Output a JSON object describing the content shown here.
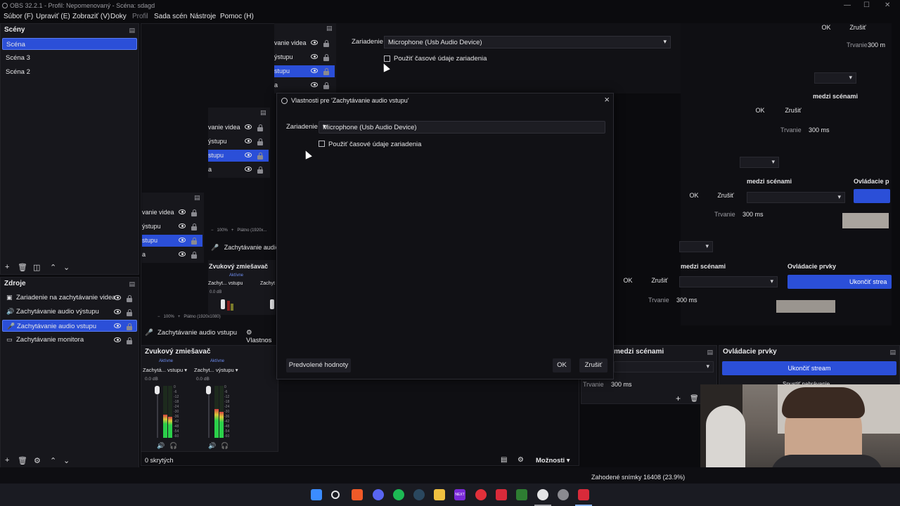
{
  "window": {
    "title": "OBS 32.2.1 - Profil: Nepomenovaný - Scéna: sdagd",
    "controls": [
      "—",
      "☐",
      "✕"
    ]
  },
  "menu": [
    "Súbor (F)",
    "Upraviť (E)",
    "Zobraziť (V)",
    "Doky",
    "Profil",
    "Sada scén",
    "Nástroje",
    "Pomoc (H)"
  ],
  "scenes": {
    "title": "Scény",
    "items": [
      "Scéna",
      "Scéna 3",
      "Scéna 2"
    ],
    "selected_index": 0
  },
  "sources": {
    "title": "Zdroje",
    "items": [
      {
        "label": "Zariadenie na zachytávanie videa",
        "icon": "camera-icon"
      },
      {
        "label": "Zachytávanie audio výstupu",
        "icon": "speaker-icon"
      },
      {
        "label": "Zachytávanie audio vstupu",
        "icon": "microphone-icon"
      },
      {
        "label": "Zachytávanie monitora",
        "icon": "monitor-icon"
      }
    ],
    "selected_index": 2
  },
  "ghost_sources": {
    "a": [
      "vanie videa",
      "ýstupu",
      "stupu",
      "a"
    ],
    "b": [
      "vanie videa",
      "ýstupu",
      "stupu",
      "a"
    ],
    "c": [
      "vanie videa",
      "ýstupu",
      "stupu",
      "a"
    ]
  },
  "zoom_row_a": {
    "zoom": "100%",
    "res": "Plátno (1920x..."
  },
  "zoom_row_b": {
    "zoom": "100%",
    "res": "Plátno (1920x1080)"
  },
  "ghost_audio_label": "Zachytávanie audio",
  "ghost_mixer_a": {
    "title": "Zvukový zmiešavač",
    "status": "Aktívne",
    "ch1": "Zachyt... vstupu",
    "ch2": "Zachyt",
    "db": "0.0 dB"
  },
  "source_bar": {
    "label": "Zachytávanie audio vstupu",
    "props": "Vlastnos"
  },
  "mixer": {
    "title": "Zvukový zmiešavač",
    "channels": [
      {
        "status": "Aktívne",
        "name": "Zachytá... vstupu",
        "db": "0.0 dB"
      },
      {
        "status": "Aktívne",
        "name": "Zachyt... výstupu",
        "db": "0.0 dB"
      }
    ],
    "scale": [
      "0",
      "-6",
      "-12",
      "-18",
      "-24",
      "-30",
      "-36",
      "-42",
      "-48",
      "-54",
      "-60"
    ],
    "levels": [
      0.45,
      0.55
    ]
  },
  "hidden_count": "0 skrytých",
  "options_label": "Možnosti",
  "dialog": {
    "title": "Vlastnosti pre 'Zachytávanie audio vstupu'",
    "device_label": "Zariadenie",
    "device_value": "Microphone (Usb Audio Device)",
    "checkbox_label": "Použiť časové údaje zariadenia",
    "defaults_button": "Predvolené hodnoty",
    "ok_button": "OK",
    "cancel_button": "Zrušiť"
  },
  "ghost_dialog": {
    "device_label": "Zariadenie",
    "device_value": "Microphone (Usb Audio Device)",
    "checkbox_label": "Použiť časové údaje zariadenia"
  },
  "right_panel": {
    "ok": "OK",
    "cancel": "Zrušiť",
    "duration_label": "Trvanie",
    "duration_value": "300 ms",
    "duration_value_short": "300 m",
    "transitions_title": "medzi scénami",
    "controls_title": "Ovládacie prvky",
    "controls_title_short": "Ovládacie p",
    "stop_stream": "Ukončiť stream",
    "stop_stream_short": "Ukončiť strea",
    "partial_text": "Spustiť nahrávanie"
  },
  "status": {
    "dropped": "Zahodené snímky 16408 (23.9%)"
  },
  "taskbar": [
    "windows-icon",
    "search-icon",
    "brave-icon",
    "discord-icon",
    "spotify-icon",
    "steam-icon",
    "folder-icon",
    "next-icon",
    "app-red-icon",
    "app-red2-icon",
    "app-green-icon",
    "obs-icon",
    "settings-icon",
    "app-active-icon"
  ],
  "taskbar_labels": {
    "next": "NEXT"
  }
}
